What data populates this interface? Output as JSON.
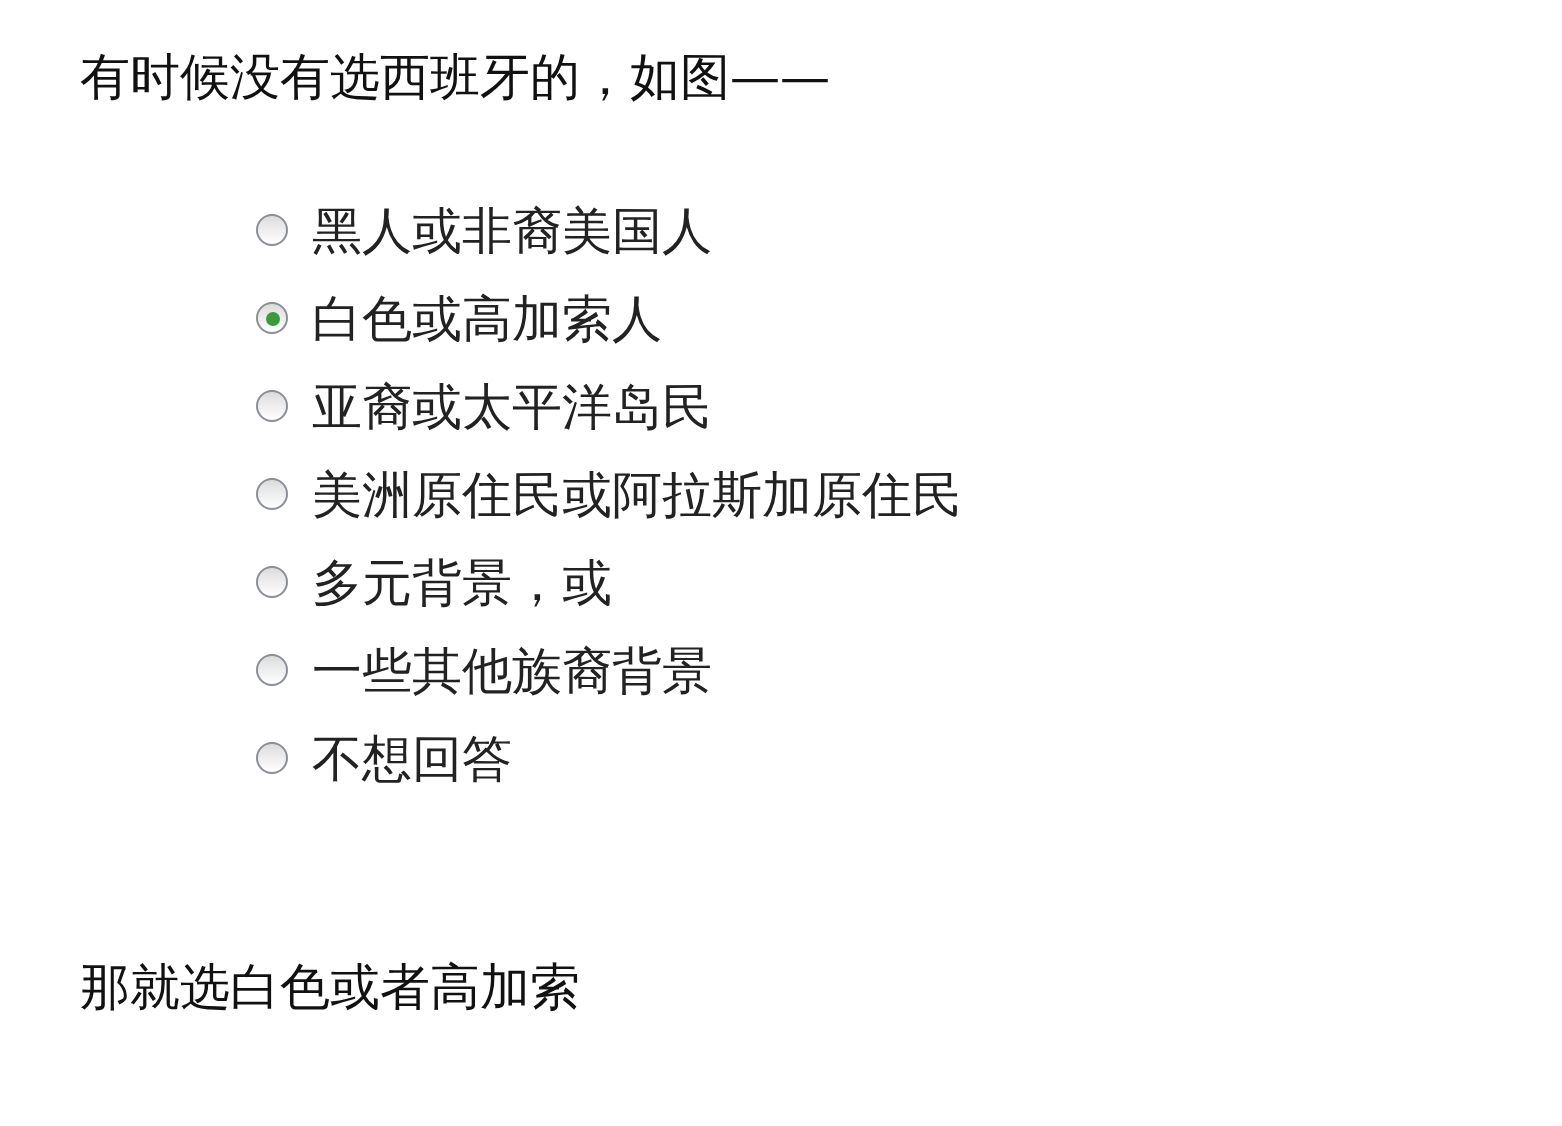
{
  "intro": "有时候没有选西班牙的，如图——",
  "options": [
    {
      "label": "黑人或非裔美国人",
      "selected": false
    },
    {
      "label": "白色或高加索人",
      "selected": true
    },
    {
      "label": "亚裔或太平洋岛民",
      "selected": false
    },
    {
      "label": "美洲原住民或阿拉斯加原住民",
      "selected": false
    },
    {
      "label": "多元背景，或",
      "selected": false
    },
    {
      "label": "一些其他族裔背景",
      "selected": false
    },
    {
      "label": "不想回答",
      "selected": false
    }
  ],
  "conclusion": "那就选白色或者高加索"
}
